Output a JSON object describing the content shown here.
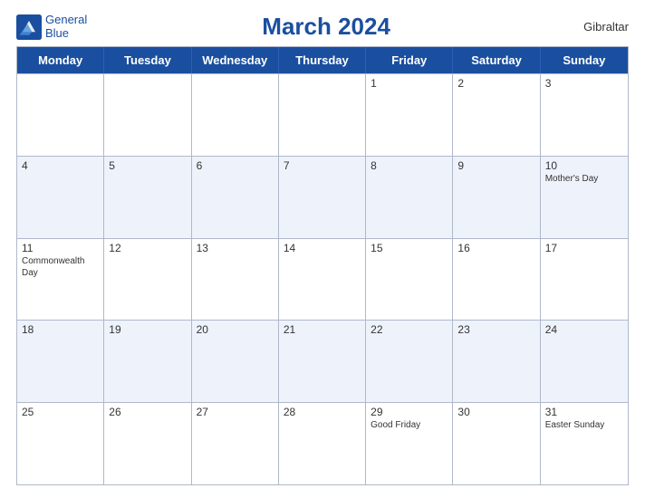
{
  "header": {
    "title": "March 2024",
    "region": "Gibraltar",
    "logo_line1": "General",
    "logo_line2": "Blue"
  },
  "weekdays": [
    "Monday",
    "Tuesday",
    "Wednesday",
    "Thursday",
    "Friday",
    "Saturday",
    "Sunday"
  ],
  "weeks": [
    [
      {
        "day": "",
        "event": ""
      },
      {
        "day": "",
        "event": ""
      },
      {
        "day": "",
        "event": ""
      },
      {
        "day": "",
        "event": ""
      },
      {
        "day": "1",
        "event": ""
      },
      {
        "day": "2",
        "event": ""
      },
      {
        "day": "3",
        "event": ""
      }
    ],
    [
      {
        "day": "4",
        "event": ""
      },
      {
        "day": "5",
        "event": ""
      },
      {
        "day": "6",
        "event": ""
      },
      {
        "day": "7",
        "event": ""
      },
      {
        "day": "8",
        "event": ""
      },
      {
        "day": "9",
        "event": ""
      },
      {
        "day": "10",
        "event": "Mother's Day"
      }
    ],
    [
      {
        "day": "11",
        "event": "Commonwealth Day"
      },
      {
        "day": "12",
        "event": ""
      },
      {
        "day": "13",
        "event": ""
      },
      {
        "day": "14",
        "event": ""
      },
      {
        "day": "15",
        "event": ""
      },
      {
        "day": "16",
        "event": ""
      },
      {
        "day": "17",
        "event": ""
      }
    ],
    [
      {
        "day": "18",
        "event": ""
      },
      {
        "day": "19",
        "event": ""
      },
      {
        "day": "20",
        "event": ""
      },
      {
        "day": "21",
        "event": ""
      },
      {
        "day": "22",
        "event": ""
      },
      {
        "day": "23",
        "event": ""
      },
      {
        "day": "24",
        "event": ""
      }
    ],
    [
      {
        "day": "25",
        "event": ""
      },
      {
        "day": "26",
        "event": ""
      },
      {
        "day": "27",
        "event": ""
      },
      {
        "day": "28",
        "event": ""
      },
      {
        "day": "29",
        "event": "Good Friday"
      },
      {
        "day": "30",
        "event": ""
      },
      {
        "day": "31",
        "event": "Easter Sunday"
      }
    ]
  ],
  "colors": {
    "header_bg": "#1a4fa0",
    "header_text": "#ffffff",
    "accent": "#1a4fa0"
  }
}
